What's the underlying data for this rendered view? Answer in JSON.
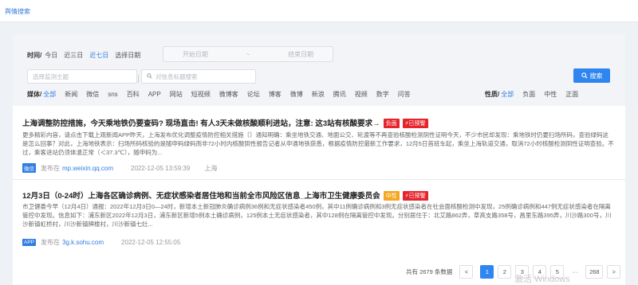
{
  "breadcrumb": "舆情搜索",
  "time_filter": {
    "label": "时间/",
    "options": [
      "今日",
      "近三日",
      "近七日",
      "选择日期"
    ],
    "active": "近七日",
    "start_placeholder": "开始日期",
    "range_sep": "~",
    "end_placeholder": "结束日期"
  },
  "search": {
    "topic_placeholder": "选择监测主题",
    "keyword_placeholder": "对信息标题搜索",
    "button_label": "搜索",
    "button_icon": "search-icon"
  },
  "media_filter": {
    "label": "媒体/",
    "options": [
      "全部",
      "新闻",
      "微信",
      "sns",
      "百科",
      "APP",
      "网站",
      "短视频",
      "微博客",
      "论坛",
      "博客",
      "微博",
      "新浪",
      "腾讯",
      "视频",
      "数字",
      "问答"
    ],
    "active": "全部"
  },
  "nature_filter": {
    "label": "性质/",
    "options": [
      "全部",
      "负面",
      "中性",
      "正面"
    ],
    "active": "全部"
  },
  "articles": [
    {
      "title": "上海调整防控措施，今天乘地铁仍要查码? 现场直击! 有人3天未做核酸顺利进站，注意: 这3站有核酸要求→",
      "sentiment": "负面",
      "alert": "已预警",
      "body": "更多精彩内容，请点击下载上观新闻APP昨天，上海发布优化调整疫情防控相关措施〔〕通知明确：乘坐地铁交通、地面公交、轮渡等不再查验核酸检测阴性证明今天，不少市民却发现：乘地铁时仍要扫场所码，查验绿码这是怎么回事？对此，上海地铁表示：扫场所码核验的是随申码绿码而非72小时内核酸阴性报告记者从申通地铁获悉，根据疫情防控最新工作要求，12月5日首班车起，乘坐上海轨道交通，取消72小时核酸检测阴性证明查验。不过，乘客进站仍须体温正常（＜37.3℃），随申码为...",
      "source_badge": "微信",
      "published_label": "发布在",
      "url": "mp.weixin.qq.com",
      "time": "2022-12-05 13:59:39",
      "location": "上海"
    },
    {
      "title": "12月3日（0-24时）上海各区确诊病例、无症状感染者居住地和当前全市风险区信息_上海市卫生健康委员会",
      "sentiment": "中性",
      "alert": "已预警",
      "body": "市卫健委今早（12月4日）通报：2022年12月3日0—24时，新增本土新冠肺炎确诊病例36例和无症状感染者450例，其中11例确诊病例和3例无症状感染者在社会面核酸检测中发现，25例确诊病例和447例无症状感染者在隔离管控中发现。信息如下：浦东新区2022年12月3日，浦东新区新增5例本土确诊病例，125例本土无症状感染者，其中128例在隔离管控中发现。分别居住于：北艾路862弄，草高支路358号，昌里东路395弄，川沙路300号，川沙新镇虹桥村，川沙新镇牌楼村，川沙新镇七灶...",
      "source_badge": "APP",
      "published_label": "发布在",
      "url": "3g.k.sohu.com",
      "time": "2022-12-05 12:55:05",
      "location": ""
    }
  ],
  "pagination": {
    "total_text": "共有 2679 条数据",
    "prev": "<",
    "pages": [
      "1",
      "2",
      "3",
      "4",
      "5"
    ],
    "ellipsis": "···",
    "last": "268",
    "next": ">",
    "active": "1"
  },
  "watermark": "激活 Windows",
  "colors": {
    "accent": "#2f86f0",
    "negative": "#e5242b",
    "neutral": "#f5a623"
  }
}
